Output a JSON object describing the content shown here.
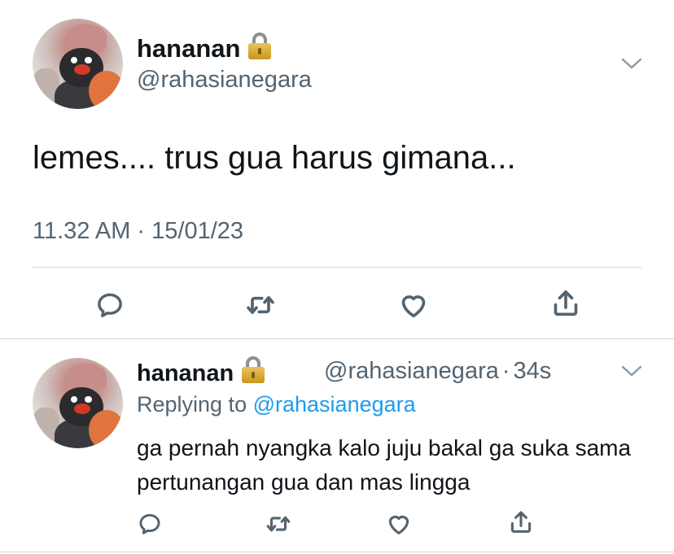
{
  "main_tweet": {
    "display_name": "hananan",
    "handle": "@rahasianegara",
    "text": "lemes.... trus gua harus gimana...",
    "timestamp": "11.32 AM · 15/01/23",
    "protected_icon": "lock-icon",
    "more_icon": "chevron-down-icon"
  },
  "reply_tweet": {
    "display_name": "hananan",
    "handle": "@rahasianegara",
    "separator": "·",
    "age": "34s",
    "replying_label": "Replying to",
    "replying_mention": "@rahasianegara",
    "text": "ga pernah nyangka kalo juju bakal ga suka sama pertunangan gua dan mas lingga",
    "protected_icon": "lock-icon",
    "more_icon": "chevron-down-icon"
  },
  "actions": [
    "reply-icon",
    "retweet-icon",
    "like-icon",
    "share-icon"
  ],
  "colors": {
    "text": "#0f1419",
    "secondary": "#536471",
    "link": "#1d9bf0",
    "divider": "#cfd9de"
  }
}
